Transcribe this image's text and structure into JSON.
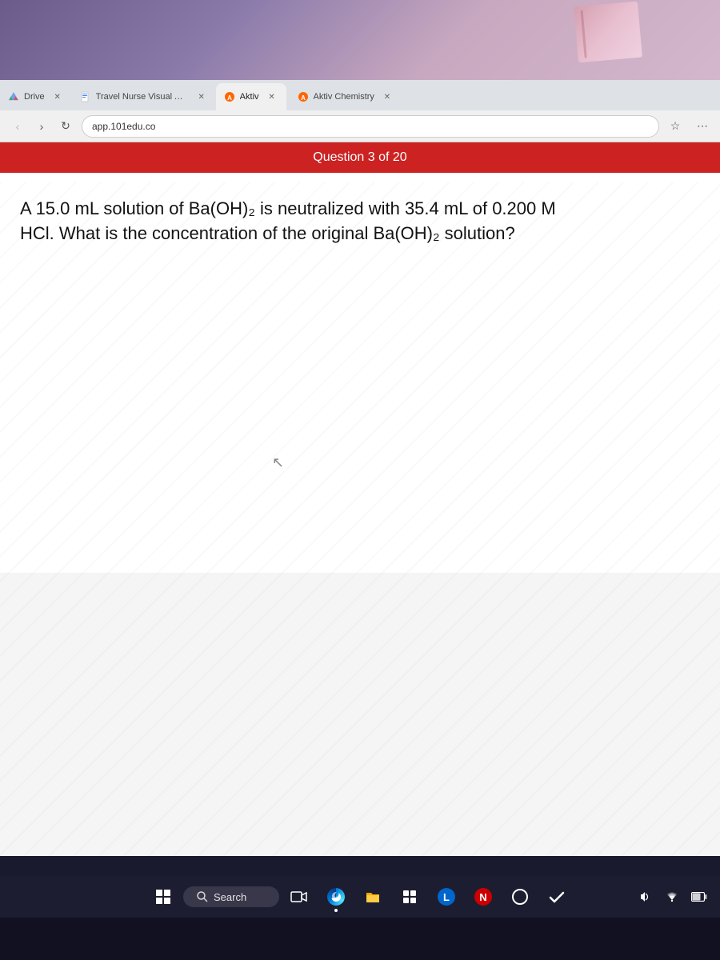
{
  "browser": {
    "tabs": [
      {
        "id": "drive",
        "label": "Drive",
        "active": false,
        "icon": "drive"
      },
      {
        "id": "travel-nurse",
        "label": "Travel Nurse Visual Aid - Google",
        "active": false,
        "icon": "doc"
      },
      {
        "id": "aktiv",
        "label": "Aktiv",
        "active": true,
        "icon": "aktiv"
      },
      {
        "id": "aktiv-chemistry",
        "label": "Aktiv Chemistry",
        "active": false,
        "icon": "aktiv-chem"
      }
    ],
    "address": "app.101edu.co",
    "nav": {
      "back": "‹",
      "forward": "›",
      "refresh": "↻",
      "home": "⌂"
    }
  },
  "question": {
    "header": "Question 3 of 20",
    "text_line1": "A 15.0 mL solution of Ba(OH)₂ is neutralized with 35.4 mL of 0.200 M",
    "text_line2": "HCl. What is the concentration of the original Ba(OH)₂ solution?"
  },
  "taskbar": {
    "search_placeholder": "Search",
    "items": [
      {
        "id": "windows",
        "icon": "windows-icon"
      },
      {
        "id": "search",
        "icon": "search-icon"
      },
      {
        "id": "video",
        "icon": "video-icon"
      },
      {
        "id": "edge",
        "icon": "edge-icon"
      },
      {
        "id": "file",
        "icon": "file-icon"
      },
      {
        "id": "grid",
        "icon": "grid-icon"
      },
      {
        "id": "letter-l",
        "label": "L",
        "color": "#0066cc"
      },
      {
        "id": "letter-n",
        "label": "N",
        "color": "#cc0000"
      },
      {
        "id": "circle",
        "icon": "circle-icon"
      },
      {
        "id": "check",
        "icon": "check-icon"
      }
    ]
  },
  "colors": {
    "tab_bar_bg": "#dee1e6",
    "active_tab_bg": "#f0f0f0",
    "question_header_bg": "#cc2222",
    "taskbar_bg": "rgba(30,30,50,0.95)"
  }
}
